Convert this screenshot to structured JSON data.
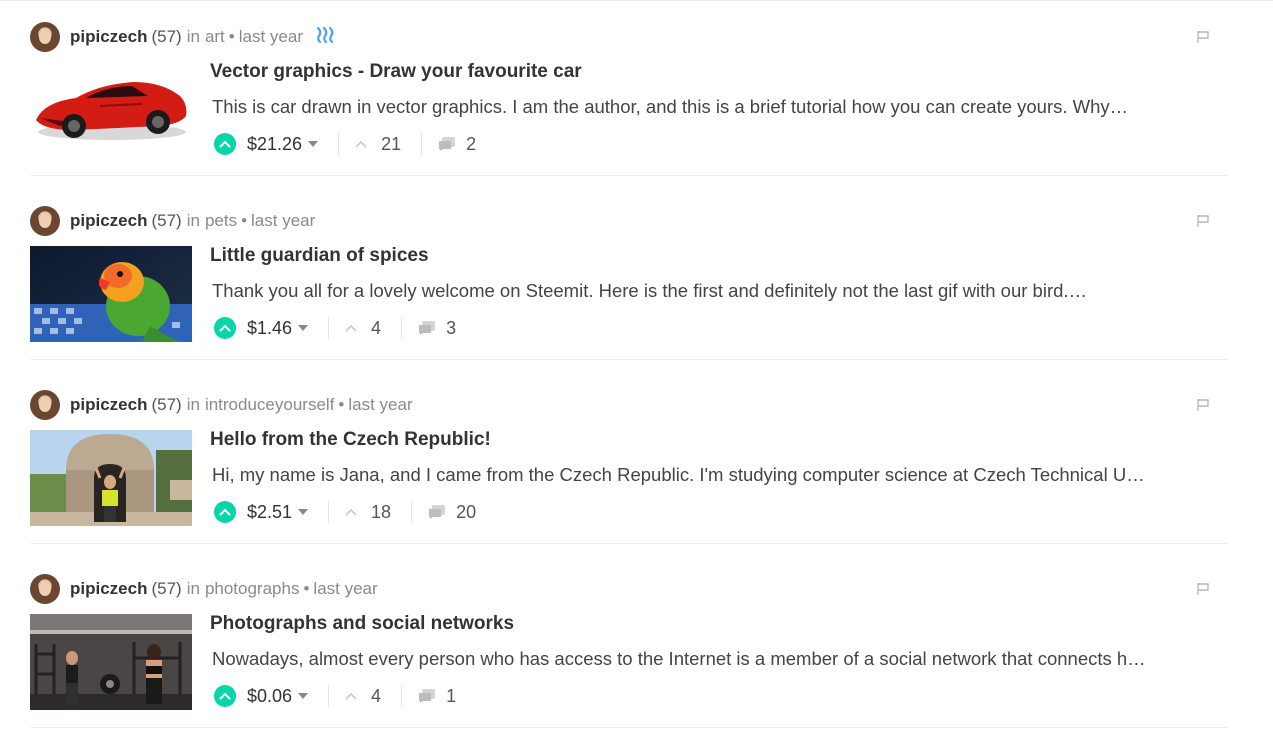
{
  "posts": [
    {
      "author": "pipiczech",
      "reputation": "(57)",
      "in_label": "in",
      "category": "art",
      "separator": "•",
      "time": "last year",
      "has_steem_icon": true,
      "title": "Vector graphics - Draw your favourite car",
      "summary": "This is car drawn in vector graphics. I am the author, and this is a brief tutorial how you can create yours. Why…",
      "payout": "$21.26",
      "votes": "21",
      "comments": "2",
      "thumbnail": "red-sports-car"
    },
    {
      "author": "pipiczech",
      "reputation": "(57)",
      "in_label": "in",
      "category": "pets",
      "separator": "•",
      "time": "last year",
      "has_steem_icon": false,
      "title": "Little guardian of spices",
      "summary": "Thank you all for a lovely welcome on Steemit. Here is the first and definitely not the last gif with our bird.…",
      "payout": "$1.46",
      "votes": "4",
      "comments": "3",
      "thumbnail": "lovebird-parrot"
    },
    {
      "author": "pipiczech",
      "reputation": "(57)",
      "in_label": "in",
      "category": "introduceyourself",
      "separator": "•",
      "time": "last year",
      "has_steem_icon": false,
      "title": "Hello from the Czech Republic!",
      "summary": "Hi, my name is Jana, and I came from the Czech Republic. I'm studying computer science at Czech Technical U…",
      "payout": "$2.51",
      "votes": "18",
      "comments": "20",
      "thumbnail": "woman-in-stone-tower"
    },
    {
      "author": "pipiczech",
      "reputation": "(57)",
      "in_label": "in",
      "category": "photographs",
      "separator": "•",
      "time": "last year",
      "has_steem_icon": false,
      "title": "Photographs and social networks",
      "summary": "Nowadays, almost every person who has access to the Internet is a member of a social network that connects h…",
      "payout": "$0.06",
      "votes": "4",
      "comments": "1",
      "thumbnail": "women-in-gym"
    }
  ],
  "colors": {
    "upvote": "#06d6a9",
    "steem_icon": "#4ba2f2",
    "meta_text": "#8a8a8a"
  },
  "icons": {
    "flag": "flag-icon",
    "upvote": "upvote-circle-icon",
    "caret": "caret-down-icon",
    "votes": "chevron-up-icon",
    "comments": "comment-bubble-icon",
    "steem": "steem-logo-icon"
  }
}
